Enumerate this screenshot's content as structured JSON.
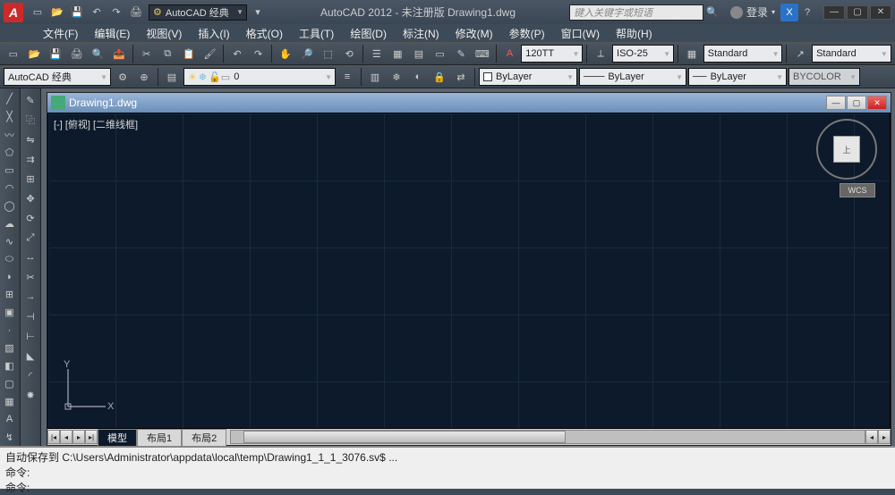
{
  "titlebar": {
    "workspace": "AutoCAD 经典",
    "title": "AutoCAD 2012 - 未注册版    Drawing1.dwg",
    "search_placeholder": "键入关键字或短语",
    "login": "登录"
  },
  "menus": [
    "文件(F)",
    "编辑(E)",
    "视图(V)",
    "插入(I)",
    "格式(O)",
    "工具(T)",
    "绘图(D)",
    "标注(N)",
    "修改(M)",
    "参数(P)",
    "窗口(W)",
    "帮助(H)"
  ],
  "toolbar1": {
    "textstyle_value": "120TT",
    "dimstyle": "ISO-25",
    "standard1": "Standard",
    "standard2": "Standard"
  },
  "toolbar2": {
    "workspace": "AutoCAD 经典",
    "layer": "0",
    "prop1": "ByLayer",
    "prop2": "ByLayer",
    "prop3": "ByLayer",
    "color": "BYCOLOR"
  },
  "doc": {
    "title": "Drawing1.dwg",
    "view_label": "[-] [俯视] [二维线框]",
    "wcs": "WCS",
    "cube_face": "上"
  },
  "tabs": {
    "model": "模型",
    "layout1": "布局1",
    "layout2": "布局2"
  },
  "cmd": {
    "line1": "自动保存到 C:\\Users\\Administrator\\appdata\\local\\temp\\Drawing1_1_1_3076.sv$ ...",
    "line2": "命令:",
    "line3": "命令:"
  },
  "axes": {
    "x": "X",
    "y": "Y"
  }
}
